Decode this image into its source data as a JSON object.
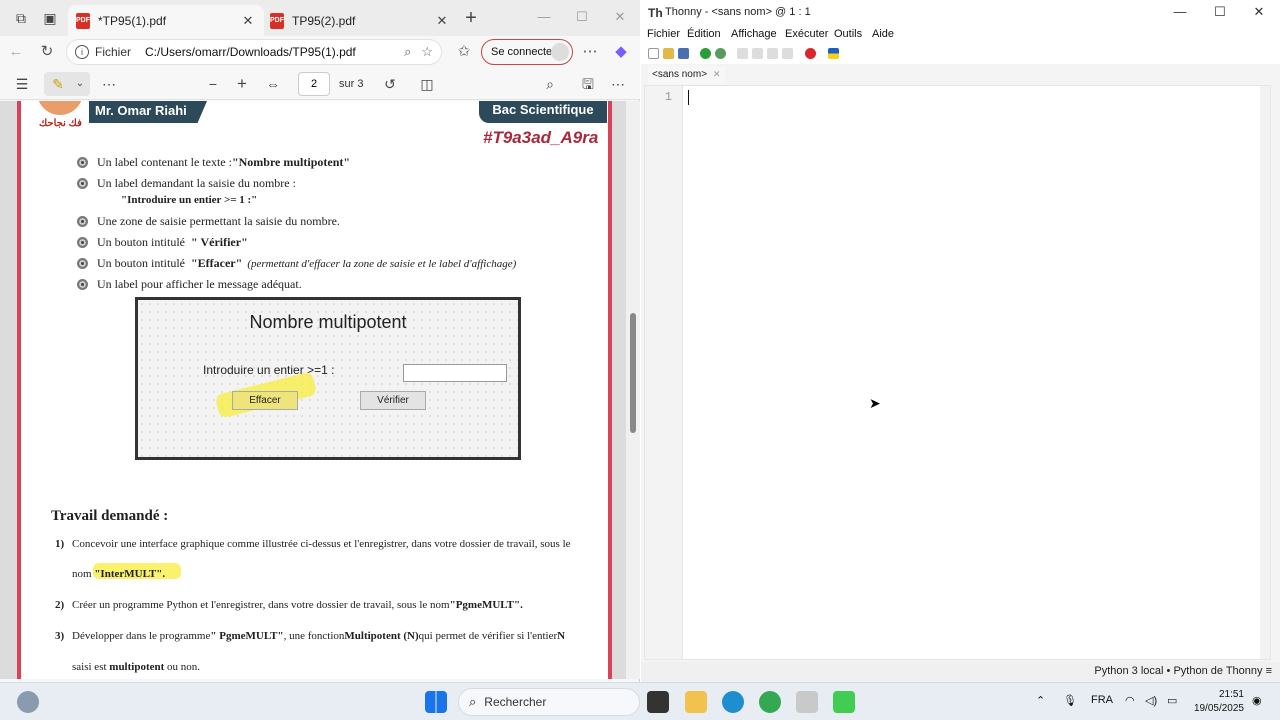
{
  "edge": {
    "tabs": [
      {
        "label": "*TP95(1).pdf",
        "active": true
      },
      {
        "label": "TP95(2).pdf",
        "active": false
      }
    ],
    "address": {
      "site_label": "Fichier",
      "url": "C:/Users/omarr/Downloads/TP95(1).pdf"
    },
    "signin_label": "Se connecter",
    "pdf_toolbar": {
      "page": "2",
      "total": "sur 3"
    }
  },
  "pdf": {
    "header": {
      "author": "Mr. Omar Riahi",
      "logo_text": "فك نجاحك",
      "level": "Bac Scientifique",
      "hashtag": "#T9a3ad_A9ra"
    },
    "bullets": [
      {
        "text": "Un label contenant le texte : ",
        "bold": "\"Nombre multipotent\"",
        "italic": ""
      },
      {
        "text": "Un label demandant la saisie du nombre :",
        "bold": "",
        "italic": ""
      },
      {
        "text": "Une zone de saisie permettant la saisie du nombre.",
        "bold": "",
        "italic": ""
      },
      {
        "text": "Un bouton intitulé ",
        "bold": "\" Vérifier\"",
        "italic": ""
      },
      {
        "text": "Un bouton intitulé ",
        "bold": "\"Effacer\"",
        "italic": "(permettant d'effacer la zone de saisie et le label d'affichage)"
      },
      {
        "text": "Un label pour afficher le message adéquat.",
        "bold": "",
        "italic": ""
      }
    ],
    "bullet2_sub": "\"Introduire un entier  >= 1 :\"",
    "mockup": {
      "title": "Nombre multipotent",
      "label": "Introduire un entier >=1 :",
      "btn_clear": "Effacer",
      "btn_verify": "Vérifier"
    },
    "section_title": "Travail demandé :",
    "questions": [
      {
        "n": "1)",
        "text": "Concevoir une interface graphique comme illustrée ci-dessus et l'enregistrer, dans votre dossier de travail, sous le"
      },
      {
        "n": "2)",
        "text": "Créer un programme Python et l'enregistrer, dans votre dossier de travail, sous le nom "
      },
      {
        "n": "3)",
        "text": "Développer dans le programme "
      }
    ],
    "q1_cont_pre": "nom ",
    "q1_cont_bold": "\"InterMULT\".",
    "q2_bold": "\"PgmeMULT\".",
    "q3_part1": "\" PgmeMULT\"",
    "q3_part2": ", une fonction ",
    "q3_part3": "Multipotent (N)",
    "q3_part4": " qui permet de vérifier si l'entier ",
    "q3_part5": "N",
    "q3_cont_pre": "saisi est ",
    "q3_cont_bold": "multipotent",
    "q3_cont_post": " ou non."
  },
  "thonny": {
    "title": "Thonny  -  <sans nom>  @  1 : 1",
    "menu": [
      "Fichier",
      "Édition",
      "Affichage",
      "Exécuter",
      "Outils",
      "Aide"
    ],
    "tab": "<sans nom>",
    "line_number": "1",
    "status": "Python 3 local  •  Python de Thonny  ≡"
  },
  "taskbar": {
    "search": "Rechercher",
    "lang": "FRA",
    "time": "21:51",
    "date": "19/05/2025"
  }
}
